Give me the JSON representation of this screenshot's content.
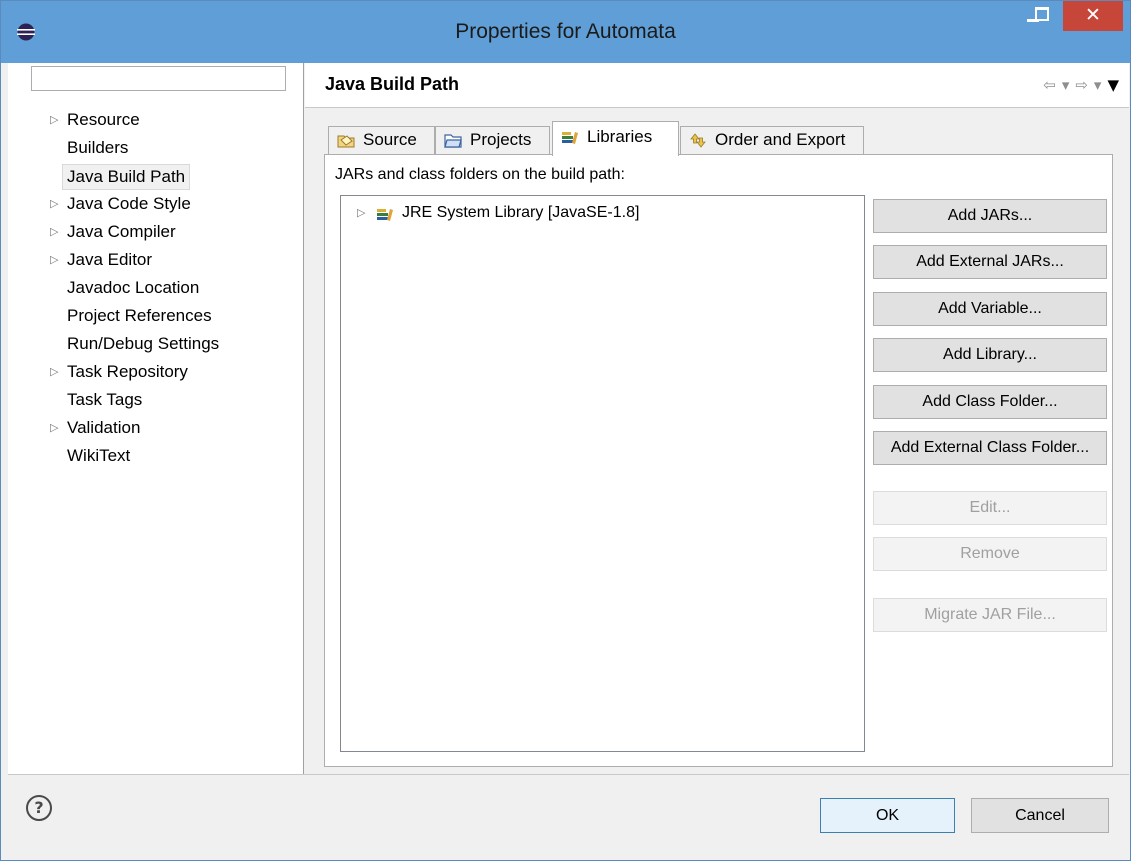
{
  "window": {
    "title": "Properties for Automata",
    "close_glyph": "✕",
    "colors": {
      "titlebar": "#5f9ed6",
      "close_button": "#c7463a"
    }
  },
  "filter": {
    "value": "",
    "placeholder": ""
  },
  "tree": {
    "items": [
      {
        "label": "Resource",
        "expandable": true
      },
      {
        "label": "Builders",
        "expandable": false
      },
      {
        "label": "Java Build Path",
        "expandable": false,
        "selected": true
      },
      {
        "label": "Java Code Style",
        "expandable": true
      },
      {
        "label": "Java Compiler",
        "expandable": true
      },
      {
        "label": "Java Editor",
        "expandable": true
      },
      {
        "label": "Javadoc Location",
        "expandable": false
      },
      {
        "label": "Project References",
        "expandable": false
      },
      {
        "label": "Run/Debug Settings",
        "expandable": false
      },
      {
        "label": "Task Repository",
        "expandable": true
      },
      {
        "label": "Task Tags",
        "expandable": false
      },
      {
        "label": "Validation",
        "expandable": true
      },
      {
        "label": "WikiText",
        "expandable": false
      }
    ]
  },
  "page": {
    "title": "Java Build Path",
    "nav_icons": [
      "back-arrow-icon",
      "back-menu-icon",
      "forward-arrow-icon",
      "forward-menu-icon",
      "view-menu-icon"
    ]
  },
  "tabs": [
    {
      "label": "Source",
      "icon": "source-folder-icon",
      "active": false
    },
    {
      "label": "Projects",
      "icon": "folder-icon",
      "active": false
    },
    {
      "label": "Libraries",
      "icon": "library-icon",
      "active": true
    },
    {
      "label": "Order and Export",
      "icon": "order-export-icon",
      "active": false
    }
  ],
  "libraries": {
    "section_label": "JARs and class folders on the build path:",
    "entries": [
      {
        "label": "JRE System Library [JavaSE-1.8]",
        "icon": "library-icon",
        "expandable": true
      }
    ],
    "buttons": [
      {
        "label": "Add JARs...",
        "enabled": true
      },
      {
        "label": "Add External JARs...",
        "enabled": true
      },
      {
        "label": "Add Variable...",
        "enabled": true
      },
      {
        "label": "Add Library...",
        "enabled": true
      },
      {
        "label": "Add Class Folder...",
        "enabled": true
      },
      {
        "label": "Add External Class Folder...",
        "enabled": true
      },
      {
        "label": "Edit...",
        "enabled": false
      },
      {
        "label": "Remove",
        "enabled": false
      },
      {
        "label": "Migrate JAR File...",
        "enabled": false
      }
    ]
  },
  "footer": {
    "help_glyph": "?",
    "ok_label": "OK",
    "cancel_label": "Cancel"
  }
}
